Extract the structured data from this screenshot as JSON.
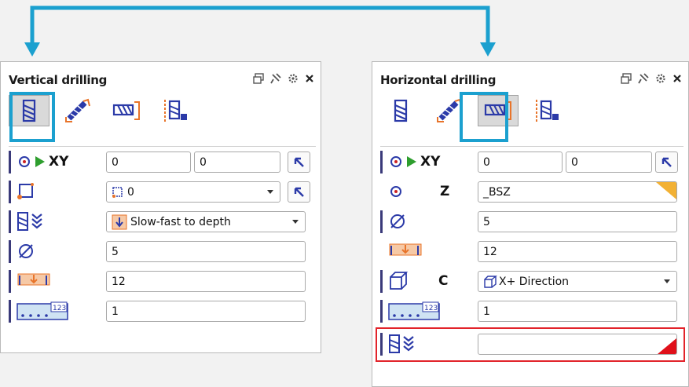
{
  "colors": {
    "connector": "#1ba0cf",
    "accent": "#e8742a",
    "error": "#e2232a",
    "warning": "#f2b134"
  },
  "vertical": {
    "title": "Vertical drilling",
    "xy_label": "XY",
    "x_value": "0",
    "y_value": "0",
    "contour_value": "0",
    "feed_mode": "Slow-fast to depth",
    "diameter": "5",
    "depth": "12",
    "count": "1"
  },
  "horizontal": {
    "title": "Horizontal drilling",
    "xy_label": "XY",
    "x_value": "0",
    "y_value": "0",
    "z_label": "Z",
    "z_value": "_BSZ",
    "diameter": "5",
    "depth": "12",
    "c_label": "C",
    "direction": "X+ Direction",
    "count": "1",
    "feed_mode": ""
  }
}
